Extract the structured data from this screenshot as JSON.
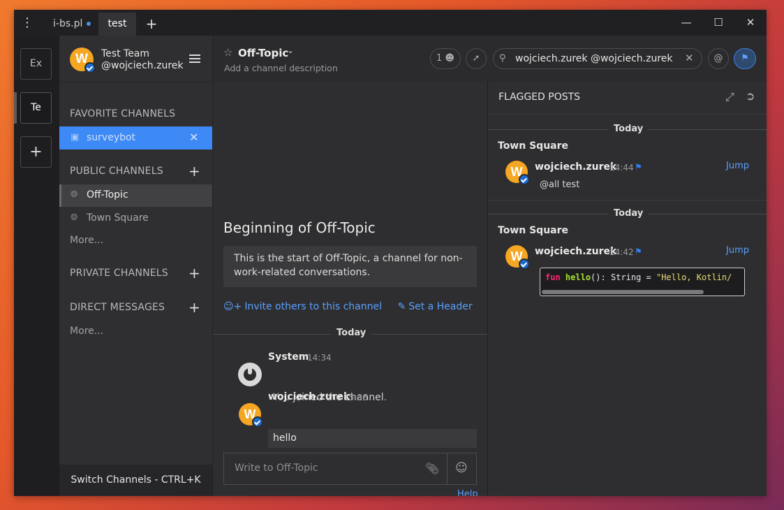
{
  "titlebar": {
    "tabs": [
      {
        "label": "i-bs.pl",
        "unread": true
      },
      {
        "label": "test",
        "active": true
      }
    ],
    "add_tab": "+",
    "menu_icon": "⋮",
    "window_controls": {
      "minimize": "—",
      "maximize": "☐",
      "close": "✕"
    }
  },
  "teams": [
    {
      "label": "Ex"
    },
    {
      "label": "Te",
      "active": true
    },
    {
      "label": "+"
    }
  ],
  "sidebar": {
    "team_name": "Test Team",
    "username": "@wojciech.zurek",
    "avatar_letter": "W",
    "favorite": {
      "title": "FAVORITE CHANNELS",
      "items": [
        {
          "label": "surveybot",
          "icon": "robot-icon",
          "remove": "✕"
        }
      ]
    },
    "public": {
      "title": "PUBLIC CHANNELS",
      "items": [
        {
          "label": "Off-Topic",
          "icon": "globe-icon",
          "active": true
        },
        {
          "label": "Town Square",
          "icon": "globe-icon"
        }
      ],
      "more": "More..."
    },
    "private": {
      "title": "PRIVATE CHANNELS"
    },
    "direct": {
      "title": "DIRECT MESSAGES",
      "more": "More..."
    },
    "switch_channels": "Switch Channels - CTRL+K"
  },
  "channel_header": {
    "title": "Off-Topic",
    "description": "Add a channel description",
    "member_count": "1",
    "search_value": "wojciech.zurek @wojciech.zurek"
  },
  "channel_intro": {
    "title": "Beginning of Off-Topic",
    "text": "This is the start of Off-Topic, a channel for non-work-related conversations.",
    "invite": "Invite others to this channel",
    "set_header": "Set a Header"
  },
  "messages": {
    "day": "Today",
    "items": [
      {
        "author": "System",
        "time": "14:34",
        "text_prefix": "You ",
        "text_bold": "joined the channel",
        "text_suffix": "."
      },
      {
        "author": "wojciech.zurek",
        "time": "15:06",
        "text": "hello",
        "avatar_letter": "W"
      }
    ]
  },
  "composer": {
    "placeholder": "Write to Off-Topic",
    "help": "Help"
  },
  "flagged": {
    "title": "FLAGGED POSTS",
    "posts": [
      {
        "day": "Today",
        "channel": "Town Square",
        "author": "wojciech.zurek",
        "time": "14:44",
        "text": "@all test",
        "jump": "Jump",
        "avatar_letter": "W"
      },
      {
        "day": "Today",
        "channel": "Town Square",
        "author": "wojciech.zurek",
        "time": "14:42",
        "jump": "Jump",
        "avatar_letter": "W",
        "code": {
          "kw": "fun",
          "fn": "hello",
          "mid": "(): String = ",
          "str": "\"Hello, Kotlin/"
        }
      }
    ]
  },
  "colors": {
    "accent": "#3d89f5",
    "avatar": "#f5a623",
    "link": "#5aa0ff"
  }
}
